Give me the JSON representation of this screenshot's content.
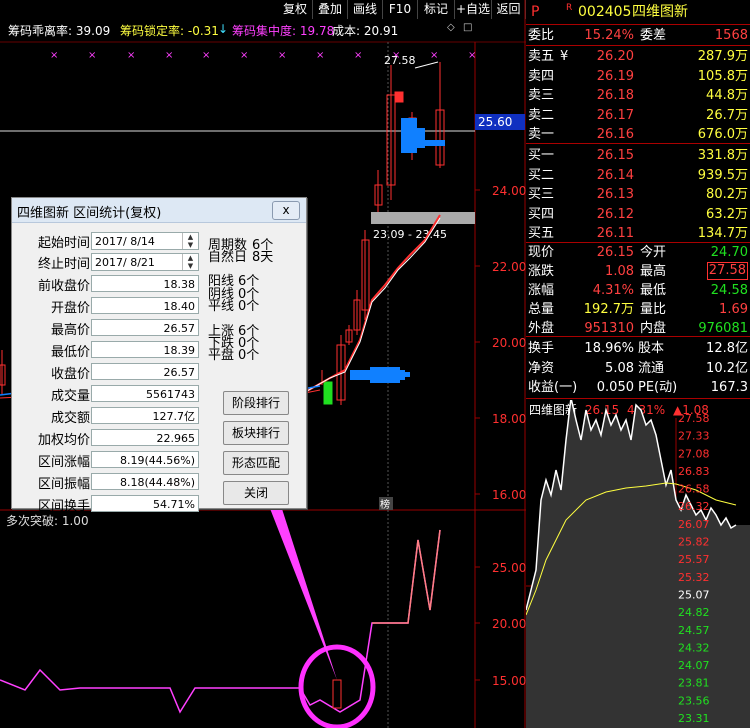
{
  "toolbar": {
    "buttons": [
      "复权",
      "叠加",
      "画线",
      "F10",
      "标记",
      "+自选",
      "返回"
    ]
  },
  "indicators": {
    "chip_deviation": "筹码乖离率: 39.09",
    "chip_lock": "筹码锁定率: -0.31",
    "chip_concentration": "筹码集中度: 19.78",
    "cost": "成本: 20.91",
    "arrow_down": "↓"
  },
  "main_chart": {
    "price_axis": [
      "24.00",
      "22.00",
      "20.00",
      "18.00",
      "16.00"
    ],
    "current_price_tag": "25.60",
    "high_label": "27.58",
    "range_label": "23.09 - 23.45",
    "time_marker": "榜"
  },
  "lower_chart": {
    "label": "多次突破: 1.00",
    "axis": [
      "25.00",
      "20.00",
      "15.00"
    ]
  },
  "quote": {
    "badge": "P",
    "superscript": "R",
    "code": "002405",
    "name": "四维图新",
    "weibi_label": "委比",
    "weibi": "15.24%",
    "weicha_label": "委差",
    "weicha": "1568",
    "asks": [
      {
        "label": "卖五",
        "price": "26.20",
        "vol": "287.9万",
        "icon": "¥"
      },
      {
        "label": "卖四",
        "price": "26.19",
        "vol": "105.8万"
      },
      {
        "label": "卖三",
        "price": "26.18",
        "vol": "44.8万"
      },
      {
        "label": "卖二",
        "price": "26.17",
        "vol": "26.7万"
      },
      {
        "label": "卖一",
        "price": "26.16",
        "vol": "676.0万"
      }
    ],
    "bids": [
      {
        "label": "买一",
        "price": "26.15",
        "vol": "331.8万"
      },
      {
        "label": "买二",
        "price": "26.14",
        "vol": "939.5万"
      },
      {
        "label": "买三",
        "price": "26.13",
        "vol": "80.2万"
      },
      {
        "label": "买四",
        "price": "26.12",
        "vol": "63.2万"
      },
      {
        "label": "买五",
        "price": "26.11",
        "vol": "134.7万"
      }
    ],
    "stats": [
      {
        "l1": "现价",
        "v1": "26.15",
        "c1": "red",
        "l2": "今开",
        "v2": "24.70",
        "c2": "green"
      },
      {
        "l1": "涨跌",
        "v1": "1.08",
        "c1": "red",
        "l2": "最高",
        "v2": "27.58",
        "c2": "red",
        "box": true
      },
      {
        "l1": "涨幅",
        "v1": "4.31%",
        "c1": "red",
        "l2": "最低",
        "v2": "24.58",
        "c2": "green"
      },
      {
        "l1": "总量",
        "v1": "192.7万",
        "c1": "yellow",
        "l2": "量比",
        "v2": "1.69",
        "c2": "red"
      },
      {
        "l1": "外盘",
        "v1": "951310",
        "c1": "red",
        "l2": "内盘",
        "v2": "976081",
        "c2": "green"
      }
    ],
    "stats2": [
      {
        "l1": "换手",
        "v1": "18.96%",
        "l2": "股本",
        "v2": "12.8亿"
      },
      {
        "l1": "净资",
        "v1": "5.08",
        "l2": "流通",
        "v2": "10.2亿"
      },
      {
        "l1": "收益(一)",
        "v1": "0.050",
        "l2": "PE(动)",
        "v2": "167.3"
      }
    ]
  },
  "mini_chart": {
    "name": "四维图新",
    "price": "26.15",
    "pct": "4.31%",
    "chg": "▲1.08",
    "axis_left": [
      "27.58",
      "27.33",
      "27.08",
      "26.83",
      "26.58",
      "26.32",
      "26.07",
      "25.82",
      "25.57",
      "25.32",
      "25.07",
      "24.82",
      "24.57",
      "24.32",
      "24.07",
      "23.81",
      "23.56",
      "23.31"
    ]
  },
  "dialog": {
    "title": "四维图新 区间统计(复权)",
    "start_label": "起始时间",
    "start_date": "2017/ 8/14",
    "end_label": "终止时间",
    "end_date": "2017/ 8/21",
    "fields": [
      {
        "label": "前收盘价",
        "value": "18.38"
      },
      {
        "label": "开盘价",
        "value": "18.40"
      },
      {
        "label": "最高价",
        "value": "26.57"
      },
      {
        "label": "最低价",
        "value": "18.39"
      },
      {
        "label": "收盘价",
        "value": "26.57"
      },
      {
        "label": "成交量",
        "value": "5561743"
      },
      {
        "label": "成交额",
        "value": "127.7亿"
      },
      {
        "label": "加权均价",
        "value": "22.965"
      },
      {
        "label": "区间涨幅",
        "value": "8.19(44.56%)"
      },
      {
        "label": "区间振幅",
        "value": "8.18(44.48%)"
      },
      {
        "label": "区间换手",
        "value": "54.71%"
      }
    ],
    "period_label": "周期数",
    "period_value": "6个",
    "natural_label": "自然日",
    "natural_value": "8天",
    "yang_label": "阳线",
    "yang_value": "6个",
    "yin_label": "阴线",
    "yin_value": "0个",
    "flat_label": "平线",
    "flat_value": "0个",
    "up_label": "上涨",
    "up_value": "6个",
    "down_label": "下跌",
    "down_value": "0个",
    "even_label": "平盘",
    "even_value": "0个",
    "buttons": [
      "阶段排行",
      "板块排行",
      "形态匹配",
      "关闭"
    ],
    "close_x": "x"
  },
  "colors": {
    "accent_magenta": "#ff40ff",
    "up_red": "#ff3030",
    "down_green": "#20e020",
    "blue_bar": "#1080ff"
  }
}
